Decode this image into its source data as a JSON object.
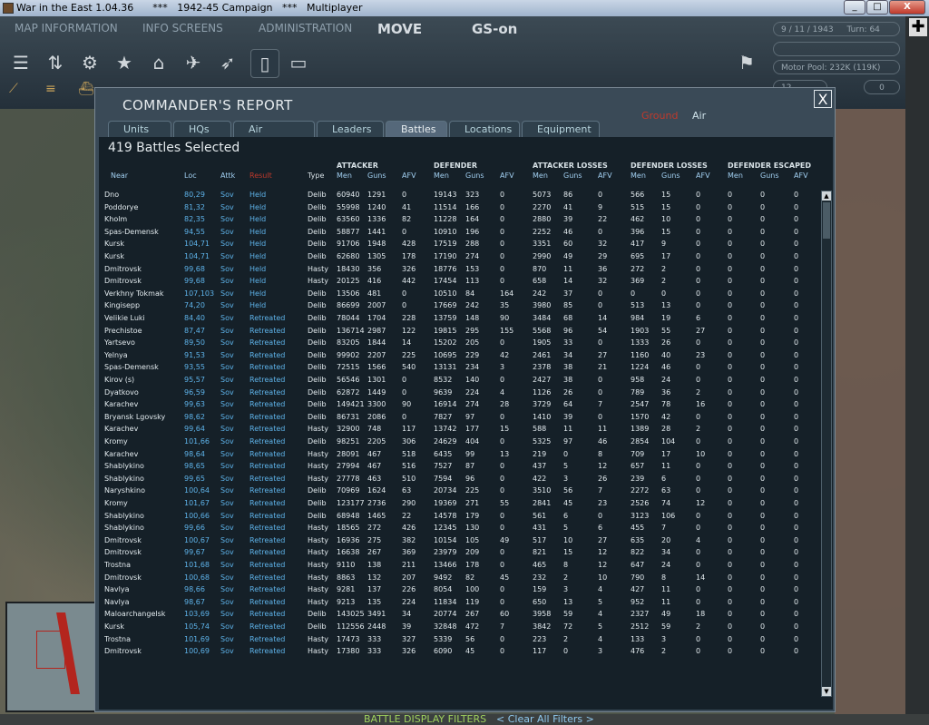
{
  "window": {
    "title": "War in the East 1.04.36      ***   1942-45 Campaign   ***   Multiplayer",
    "minimize": "_",
    "maximize": "□",
    "close": "X"
  },
  "menu": {
    "map_information": "MAP INFORMATION",
    "info_screens": "INFO SCREENS",
    "administration": "ADMINISTRATION",
    "move": "MOVE",
    "gs": "GS-on"
  },
  "status": {
    "date": "9 / 11 / 1943",
    "turn": "Turn: 64",
    "motor_pool": "Motor Pool: 232K (119K)",
    "small_left": "12",
    "small_right": "0"
  },
  "dialog": {
    "title": "COMMANDER'S REPORT",
    "filter_ground": "Ground",
    "filter_air": "Air",
    "close": "X",
    "tabs": [
      "Units",
      "HQs",
      "Air Groups",
      "Leaders",
      "Battles",
      "Locations",
      "Equipment"
    ],
    "count": "419 Battles Selected",
    "groups": {
      "attacker": "ATTACKER",
      "defender": "DEFENDER",
      "attacker_losses": "ATTACKER LOSSES",
      "defender_losses": "DEFENDER LOSSES",
      "defender_escaped": "DEFENDER ESCAPED"
    },
    "headers": {
      "near": "Near",
      "loc": "Loc",
      "attk": "Attk",
      "result": "Result",
      "type": "Type",
      "men": "Men",
      "guns": "Guns",
      "afv": "AFV"
    },
    "battle_filters": "BATTLE DISPLAY FILTERS",
    "clear_filters": "< Clear All Filters >"
  },
  "rows": [
    [
      "Dno",
      "80,29",
      "Sov",
      "Held",
      "Delib",
      "60940",
      "1291",
      "0",
      "19143",
      "323",
      "0",
      "5073",
      "86",
      "0",
      "566",
      "15",
      "0",
      "0",
      "0",
      "0"
    ],
    [
      "Poddorye",
      "81,32",
      "Sov",
      "Held",
      "Delib",
      "55998",
      "1240",
      "41",
      "11514",
      "166",
      "0",
      "2270",
      "41",
      "9",
      "515",
      "15",
      "0",
      "0",
      "0",
      "0"
    ],
    [
      "Kholm",
      "82,35",
      "Sov",
      "Held",
      "Delib",
      "63560",
      "1336",
      "82",
      "11228",
      "164",
      "0",
      "2880",
      "39",
      "22",
      "462",
      "10",
      "0",
      "0",
      "0",
      "0"
    ],
    [
      "Spas-Demensk",
      "94,55",
      "Sov",
      "Held",
      "Delib",
      "58877",
      "1441",
      "0",
      "10910",
      "196",
      "0",
      "2252",
      "46",
      "0",
      "396",
      "15",
      "0",
      "0",
      "0",
      "0"
    ],
    [
      "Kursk",
      "104,71",
      "Sov",
      "Held",
      "Delib",
      "91706",
      "1948",
      "428",
      "17519",
      "288",
      "0",
      "3351",
      "60",
      "32",
      "417",
      "9",
      "0",
      "0",
      "0",
      "0"
    ],
    [
      "Kursk",
      "104,71",
      "Sov",
      "Held",
      "Delib",
      "62680",
      "1305",
      "178",
      "17190",
      "274",
      "0",
      "2990",
      "49",
      "29",
      "695",
      "17",
      "0",
      "0",
      "0",
      "0"
    ],
    [
      "Dmitrovsk",
      "99,68",
      "Sov",
      "Held",
      "Hasty",
      "18430",
      "356",
      "326",
      "18776",
      "153",
      "0",
      "870",
      "11",
      "36",
      "272",
      "2",
      "0",
      "0",
      "0",
      "0"
    ],
    [
      "Dmitrovsk",
      "99,68",
      "Sov",
      "Held",
      "Hasty",
      "20125",
      "416",
      "442",
      "17454",
      "113",
      "0",
      "658",
      "14",
      "32",
      "369",
      "2",
      "0",
      "0",
      "0",
      "0"
    ],
    [
      "Verkhny Tokmak",
      "107,103",
      "Sov",
      "Held",
      "Delib",
      "13506",
      "481",
      "0",
      "10510",
      "84",
      "164",
      "242",
      "37",
      "0",
      "0",
      "0",
      "0",
      "0",
      "0",
      "0"
    ],
    [
      "Kingisepp",
      "74,20",
      "Sov",
      "Held",
      "Delib",
      "86699",
      "2007",
      "0",
      "17669",
      "242",
      "35",
      "3980",
      "85",
      "0",
      "513",
      "13",
      "0",
      "0",
      "0",
      "0"
    ],
    [
      "Velikie Luki",
      "84,40",
      "Sov",
      "Retreated",
      "Delib",
      "78044",
      "1704",
      "228",
      "13759",
      "148",
      "90",
      "3484",
      "68",
      "14",
      "984",
      "19",
      "6",
      "0",
      "0",
      "0"
    ],
    [
      "Prechistoe",
      "87,47",
      "Sov",
      "Retreated",
      "Delib",
      "136714",
      "2987",
      "122",
      "19815",
      "295",
      "155",
      "5568",
      "96",
      "54",
      "1903",
      "55",
      "27",
      "0",
      "0",
      "0"
    ],
    [
      "Yartsevo",
      "89,50",
      "Sov",
      "Retreated",
      "Delib",
      "83205",
      "1844",
      "14",
      "15202",
      "205",
      "0",
      "1905",
      "33",
      "0",
      "1333",
      "26",
      "0",
      "0",
      "0",
      "0"
    ],
    [
      "Yelnya",
      "91,53",
      "Sov",
      "Retreated",
      "Delib",
      "99902",
      "2207",
      "225",
      "10695",
      "229",
      "42",
      "2461",
      "34",
      "27",
      "1160",
      "40",
      "23",
      "0",
      "0",
      "0"
    ],
    [
      "Spas-Demensk",
      "93,55",
      "Sov",
      "Retreated",
      "Delib",
      "72515",
      "1566",
      "540",
      "13131",
      "234",
      "3",
      "2378",
      "38",
      "21",
      "1224",
      "46",
      "0",
      "0",
      "0",
      "0"
    ],
    [
      "Kirov (s)",
      "95,57",
      "Sov",
      "Retreated",
      "Delib",
      "56546",
      "1301",
      "0",
      "8532",
      "140",
      "0",
      "2427",
      "38",
      "0",
      "958",
      "24",
      "0",
      "0",
      "0",
      "0"
    ],
    [
      "Dyatkovo",
      "96,59",
      "Sov",
      "Retreated",
      "Delib",
      "62872",
      "1449",
      "0",
      "9639",
      "224",
      "4",
      "1126",
      "26",
      "0",
      "789",
      "36",
      "2",
      "0",
      "0",
      "0"
    ],
    [
      "Karachev",
      "99,63",
      "Sov",
      "Retreated",
      "Delib",
      "149421",
      "3300",
      "90",
      "16914",
      "274",
      "28",
      "3729",
      "64",
      "7",
      "2547",
      "78",
      "16",
      "0",
      "0",
      "0"
    ],
    [
      "Bryansk Lgovsky",
      "98,62",
      "Sov",
      "Retreated",
      "Delib",
      "86731",
      "2086",
      "0",
      "7827",
      "97",
      "0",
      "1410",
      "39",
      "0",
      "1570",
      "42",
      "0",
      "0",
      "0",
      "0"
    ],
    [
      "Karachev",
      "99,64",
      "Sov",
      "Retreated",
      "Hasty",
      "32900",
      "748",
      "117",
      "13742",
      "177",
      "15",
      "588",
      "11",
      "11",
      "1389",
      "28",
      "2",
      "0",
      "0",
      "0"
    ],
    [
      "Kromy",
      "101,66",
      "Sov",
      "Retreated",
      "Delib",
      "98251",
      "2205",
      "306",
      "24629",
      "404",
      "0",
      "5325",
      "97",
      "46",
      "2854",
      "104",
      "0",
      "0",
      "0",
      "0"
    ],
    [
      "Karachev",
      "98,64",
      "Sov",
      "Retreated",
      "Hasty",
      "28091",
      "467",
      "518",
      "6435",
      "99",
      "13",
      "219",
      "0",
      "8",
      "709",
      "17",
      "10",
      "0",
      "0",
      "0"
    ],
    [
      "Shablykino",
      "98,65",
      "Sov",
      "Retreated",
      "Hasty",
      "27994",
      "467",
      "516",
      "7527",
      "87",
      "0",
      "437",
      "5",
      "12",
      "657",
      "11",
      "0",
      "0",
      "0",
      "0"
    ],
    [
      "Shablykino",
      "99,65",
      "Sov",
      "Retreated",
      "Hasty",
      "27778",
      "463",
      "510",
      "7594",
      "96",
      "0",
      "422",
      "3",
      "26",
      "239",
      "6",
      "0",
      "0",
      "0",
      "0"
    ],
    [
      "Naryshkino",
      "100,64",
      "Sov",
      "Retreated",
      "Delib",
      "70969",
      "1624",
      "63",
      "20734",
      "225",
      "0",
      "3510",
      "56",
      "7",
      "2272",
      "63",
      "0",
      "0",
      "0",
      "0"
    ],
    [
      "Kromy",
      "101,67",
      "Sov",
      "Retreated",
      "Delib",
      "123177",
      "2736",
      "290",
      "19369",
      "271",
      "55",
      "2841",
      "45",
      "23",
      "2526",
      "74",
      "12",
      "0",
      "0",
      "0"
    ],
    [
      "Shablykino",
      "100,66",
      "Sov",
      "Retreated",
      "Delib",
      "68948",
      "1465",
      "22",
      "14578",
      "179",
      "0",
      "561",
      "6",
      "0",
      "3123",
      "106",
      "0",
      "0",
      "0",
      "0"
    ],
    [
      "Shablykino",
      "99,66",
      "Sov",
      "Retreated",
      "Hasty",
      "18565",
      "272",
      "426",
      "12345",
      "130",
      "0",
      "431",
      "5",
      "6",
      "455",
      "7",
      "0",
      "0",
      "0",
      "0"
    ],
    [
      "Dmitrovsk",
      "100,67",
      "Sov",
      "Retreated",
      "Hasty",
      "16936",
      "275",
      "382",
      "10154",
      "105",
      "49",
      "517",
      "10",
      "27",
      "635",
      "20",
      "4",
      "0",
      "0",
      "0"
    ],
    [
      "Dmitrovsk",
      "99,67",
      "Sov",
      "Retreated",
      "Hasty",
      "16638",
      "267",
      "369",
      "23979",
      "209",
      "0",
      "821",
      "15",
      "12",
      "822",
      "34",
      "0",
      "0",
      "0",
      "0"
    ],
    [
      "Trostna",
      "101,68",
      "Sov",
      "Retreated",
      "Hasty",
      "9110",
      "138",
      "211",
      "13466",
      "178",
      "0",
      "465",
      "8",
      "12",
      "647",
      "24",
      "0",
      "0",
      "0",
      "0"
    ],
    [
      "Dmitrovsk",
      "100,68",
      "Sov",
      "Retreated",
      "Hasty",
      "8863",
      "132",
      "207",
      "9492",
      "82",
      "45",
      "232",
      "2",
      "10",
      "790",
      "8",
      "14",
      "0",
      "0",
      "0"
    ],
    [
      "Navlya",
      "98,66",
      "Sov",
      "Retreated",
      "Hasty",
      "9281",
      "137",
      "226",
      "8054",
      "100",
      "0",
      "159",
      "3",
      "4",
      "427",
      "11",
      "0",
      "0",
      "0",
      "0"
    ],
    [
      "Navlya",
      "98,67",
      "Sov",
      "Retreated",
      "Hasty",
      "9213",
      "135",
      "224",
      "11834",
      "119",
      "0",
      "650",
      "13",
      "5",
      "952",
      "11",
      "0",
      "0",
      "0",
      "0"
    ],
    [
      "Maloarchangelsk",
      "103,69",
      "Sov",
      "Retreated",
      "Delib",
      "143025",
      "3491",
      "34",
      "20774",
      "267",
      "60",
      "3958",
      "59",
      "4",
      "2327",
      "49",
      "18",
      "0",
      "0",
      "0"
    ],
    [
      "Kursk",
      "105,74",
      "Sov",
      "Retreated",
      "Delib",
      "112556",
      "2448",
      "39",
      "32848",
      "472",
      "7",
      "3842",
      "72",
      "5",
      "2512",
      "59",
      "2",
      "0",
      "0",
      "0"
    ],
    [
      "Trostna",
      "101,69",
      "Sov",
      "Retreated",
      "Hasty",
      "17473",
      "333",
      "327",
      "5339",
      "56",
      "0",
      "223",
      "2",
      "4",
      "133",
      "3",
      "0",
      "0",
      "0",
      "0"
    ],
    [
      "Dmitrovsk",
      "100,69",
      "Sov",
      "Retreated",
      "Hasty",
      "17380",
      "333",
      "326",
      "6090",
      "45",
      "0",
      "117",
      "0",
      "3",
      "476",
      "2",
      "0",
      "0",
      "0",
      "0"
    ]
  ]
}
